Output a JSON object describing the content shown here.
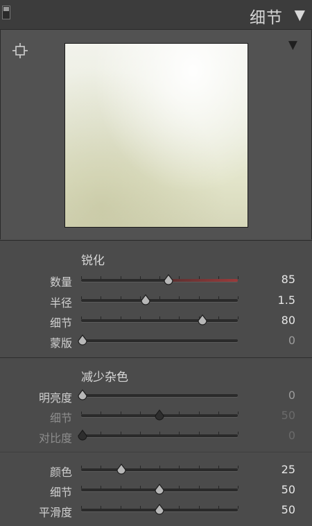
{
  "header": {
    "title": "细节",
    "collapse_glyph": "▼"
  },
  "preview": {
    "toggle_glyph": "▼"
  },
  "sharpen": {
    "title": "锐化",
    "rows": [
      {
        "label": "数量",
        "value": "85",
        "level": 0.56
      },
      {
        "label": "半径",
        "value": "1.5",
        "level": 0.41
      },
      {
        "label": "细节",
        "value": "80",
        "level": 0.78
      },
      {
        "label": "蒙版",
        "value": "0",
        "level": 0.0
      }
    ]
  },
  "noise": {
    "title": "减少杂色",
    "luminance_rows": [
      {
        "label": "明亮度",
        "value": "0",
        "level": 0.0
      },
      {
        "label": "细节",
        "value": "50",
        "level": 0.5
      },
      {
        "label": "对比度",
        "value": "0",
        "level": 0.0
      }
    ],
    "color_rows": [
      {
        "label": "颜色",
        "value": "25",
        "level": 0.25
      },
      {
        "label": "细节",
        "value": "50",
        "level": 0.5
      },
      {
        "label": "平滑度",
        "value": "50",
        "level": 0.5
      }
    ]
  }
}
